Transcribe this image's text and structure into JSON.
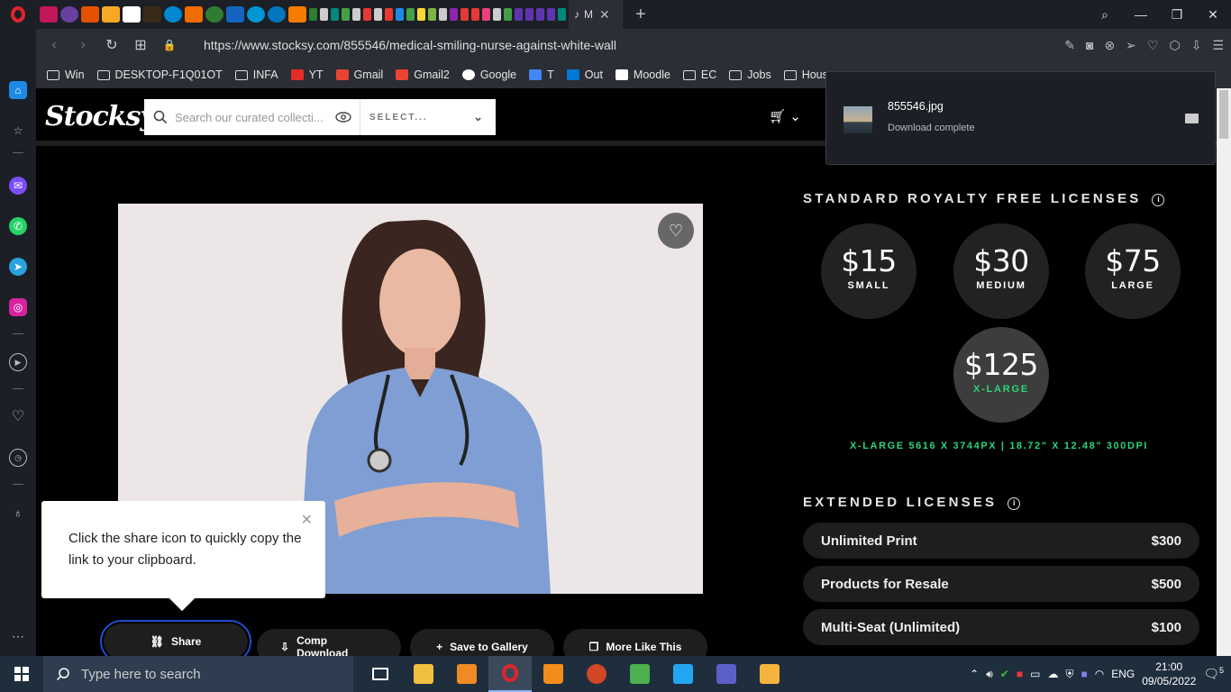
{
  "browser": {
    "active_tab_label": "M",
    "url": "https://www.stocksy.com/855546/medical-smiling-nurse-against-white-wall",
    "bookmarks": [
      "Win",
      "DESKTOP-F1Q01OT",
      "INFA",
      "YT",
      "Gmail",
      "Gmail2",
      "Google",
      "T",
      "Out",
      "Moodle",
      "EC",
      "Jobs",
      "Hous"
    ]
  },
  "download": {
    "filename": "855546.jpg",
    "status": "Download complete"
  },
  "site": {
    "logo": "Stocksy",
    "search_placeholder": "Search our curated collecti...",
    "select_label": "SELECT..."
  },
  "tooltip": {
    "text": "Click the share icon to quickly copy the link to your clipboard."
  },
  "actions": {
    "share": "Share",
    "comp_download": "Comp Download",
    "save_to_gallery": "Save to Gallery",
    "more_like_this": "More Like This"
  },
  "licenses": {
    "standard_title": "STANDARD ROYALTY FREE LICENSES",
    "sizes": [
      {
        "price": "$15",
        "label": "SMALL"
      },
      {
        "price": "$30",
        "label": "MEDIUM"
      },
      {
        "price": "$75",
        "label": "LARGE"
      },
      {
        "price": "$125",
        "label": "X-LARGE"
      }
    ],
    "selected_dims": "X-LARGE 5616 X 3744PX | 18.72\" X 12.48\" 300DPI",
    "extended_title": "EXTENDED LICENSES",
    "extended": [
      {
        "name": "Unlimited Print",
        "price": "$300"
      },
      {
        "name": "Products for Resale",
        "price": "$500"
      },
      {
        "name": "Multi-Seat (Unlimited)",
        "price": "$100"
      }
    ]
  },
  "taskbar": {
    "search_placeholder": "Type here to search",
    "language": "ENG",
    "time": "21:00",
    "date": "09/05/2022",
    "notifications": "5"
  },
  "colors": {
    "accent_green": "#2bd47a",
    "focus_blue": "#1e4ecb"
  }
}
